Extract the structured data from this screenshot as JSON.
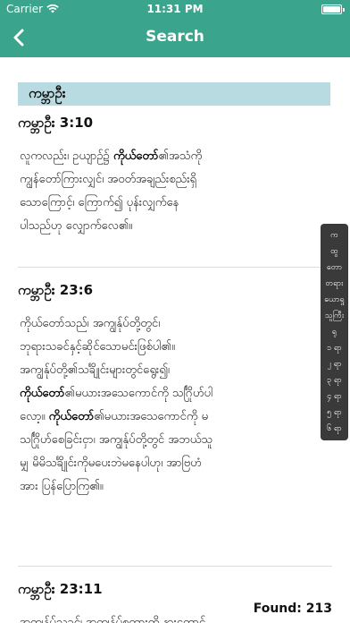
{
  "status_bar": {
    "carrier": "Carrier",
    "time": "11:31 PM",
    "battery_level": 1.0
  },
  "nav_bar": {
    "title": "Search"
  },
  "section_title": "ကမ္ဘာဦး",
  "results": [
    {
      "reference": "ကမ္ဘာဦး 3:10",
      "verse_lines": [
        [
          {
            "t": "လူကလည်း၊ ဥယျာဉ်၌ "
          },
          {
            "t": "ကိုယ်တော်",
            "b": true
          },
          {
            "t": "၏အသံကို"
          }
        ],
        [
          {
            "t": "ကျွန်တော်ကြားလျှင်၊ အဝတ်အချည်းစည်းရှိ"
          }
        ],
        [
          {
            "t": "သောကြောင့်၊ ကြောက်၍ ပုန်းလျှက်နေ"
          }
        ],
        [
          {
            "t": "ပါသည်ဟု လျှောက်လေ၏။"
          }
        ]
      ]
    },
    {
      "reference": "ကမ္ဘာဦး 23:6",
      "verse_lines": [
        [
          {
            "t": "ကိုယ်တော်သည်၊ အကျွန်ုပ်တို့တွင်၊"
          }
        ],
        [
          {
            "t": "ဘုရားသခင်နှင့်ဆိုင်သောမင်းဖြစ်ပါ၏။"
          }
        ],
        [
          {
            "t": "အကျွန်ုပ်တို့၏သင်္ချိုင်းများတွင်ရွေး၍၊"
          }
        ],
        [
          {
            "t": "ကိုယ်တော်",
            "b": true
          },
          {
            "t": "၏မယားအသေကောင်ကို သင်္ဂြိုဟ်ပါ"
          }
        ],
        [
          {
            "t": "လော့။ "
          },
          {
            "t": "ကိုယ်တော်",
            "b": true
          },
          {
            "t": "၏မယားအသေကောင်ကို မ"
          }
        ],
        [
          {
            "t": "သင်္ဂြိုဟ်စေခြင်းငှာ၊ အကျွန်ုပ်တို့တွင် အဘယ်သူ"
          }
        ],
        [
          {
            "t": "မျှ မိမိသင်္ချိုင်းကိုမပေးဘဲမနေပါဟု၊ အာဗြဟံ"
          }
        ],
        [
          {
            "t": "အား ပြန်ပြောကြ၏။"
          }
        ]
      ]
    },
    {
      "reference": "ကမ္ဘာဦး 23:11",
      "verse_lines": [
        [
          {
            "t": "အကျွန်ုပ်သခင်၊ အကျွန်ုပ်စကားကို နားထောင်"
          }
        ]
      ]
    }
  ],
  "index_items": [
    "က",
    "ထွ",
    "တော",
    "တရား",
    "ယောရှု",
    "သူကြီး",
    "ရု",
    "၁ ရာ",
    "၂ ရာ",
    "၃ ရာ",
    "၄ ရာ",
    "၅ ရာ",
    "၆ ရာ"
  ],
  "found": {
    "label": "Found:",
    "count": "213"
  },
  "colors": {
    "accent": "#3aa48c",
    "section_bg": "#b8dbe1",
    "index_bg": "#3a3a3a"
  }
}
